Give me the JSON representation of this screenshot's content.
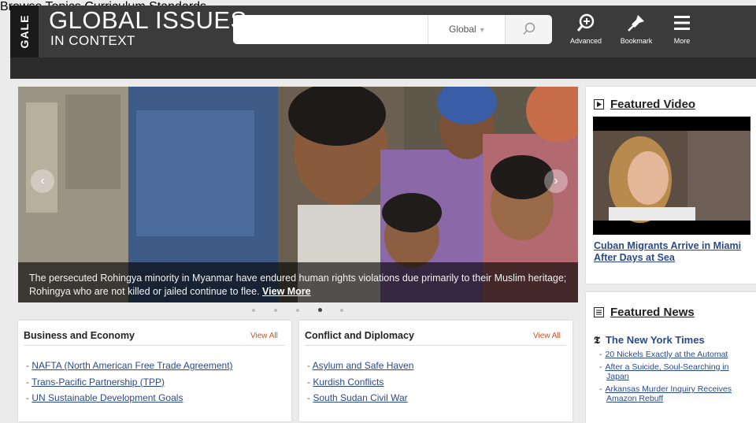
{
  "brand": {
    "logo": "GALE",
    "title": "GLOBAL ISSUES",
    "subtitle": "IN CONTEXT"
  },
  "search": {
    "value": "",
    "placeholder": "",
    "scope": "Global"
  },
  "toolbar": {
    "advanced": "Advanced",
    "bookmark": "Bookmark",
    "more": "More"
  },
  "nav": {
    "items": [
      "Browse Topics",
      "Curriculum Standards"
    ]
  },
  "hero": {
    "caption": "The persecuted Rohingya minority in Myanmar have endured human rights violations due primarily to their Muslim heritage; Rohingya who are not killed or jailed continue to flee.",
    "link": "View More",
    "slides": 5,
    "active_slide": 4
  },
  "panels": [
    {
      "title": "Business and Economy",
      "view_all": "View All",
      "items": [
        "NAFTA (North American Free Trade Agreement)",
        "Trans-Pacific Partnership (TPP)",
        "UN Sustainable Development Goals"
      ]
    },
    {
      "title": "Conflict and Diplomacy",
      "view_all": "View All",
      "items": [
        "Asylum and Safe Haven",
        "Kurdish Conflicts",
        "South Sudan Civil War"
      ]
    }
  ],
  "featured_video": {
    "heading": "Featured Video",
    "title": "Cuban Migrants Arrive in Miami After Days at Sea"
  },
  "featured_news": {
    "heading": "Featured News",
    "source": "The New York Times",
    "items": [
      "20 Nickels Exactly at the Automat",
      "After a Suicide, Soul-Searching in",
      "Japan",
      "Arkansas Murder Inquiry Receives",
      "Amazon Rebuff"
    ]
  },
  "colors": {
    "header": "#3b3b3b",
    "subnav": "#2c2c2c",
    "link": "#2a4a8a",
    "accent": "#c0562f"
  }
}
